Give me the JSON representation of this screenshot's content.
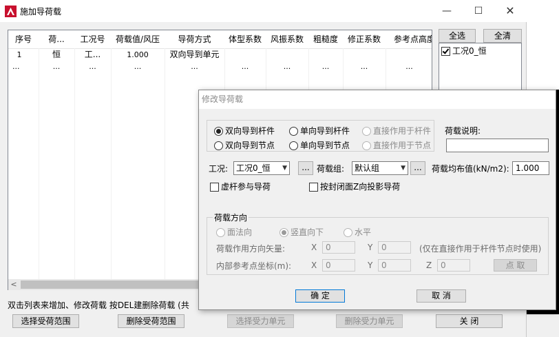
{
  "window": {
    "title": "施加导荷载",
    "minimize_glyph": "—",
    "maximize_glyph": "☐",
    "close_glyph": "✕"
  },
  "list": {
    "columns": [
      "序号",
      "荷...",
      "工况号",
      "荷载值/风压",
      "导荷方式",
      "体型系数",
      "风振系数",
      "粗糙度",
      "修正系数",
      "参考点高度"
    ],
    "rows": [
      [
        "1",
        "恒",
        "工...",
        "1.000",
        "双向导到单元",
        "",
        "",
        "",
        "",
        ""
      ],
      [
        "...",
        "...",
        "...",
        "...",
        "...",
        "...",
        "...",
        "...",
        "...",
        "..."
      ]
    ],
    "scroll_left_glyph": "<"
  },
  "side": {
    "select_all": "全选",
    "clear_all": "全清",
    "cases": [
      {
        "label": "工况0_恒",
        "checked": true
      }
    ]
  },
  "hint": "双击列表来增加、修改荷载   按DEL建删除荷载   (共",
  "bottom_buttons": {
    "select_range": "选择受荷范围",
    "delete_range": "删除受荷范围",
    "select_units": "选择受力单元",
    "delete_units": "删除受力单元",
    "close": "关    闭"
  },
  "dialog": {
    "title": "修改导荷载",
    "modes": [
      {
        "label": "双向导到杆件",
        "selected": true,
        "enabled": true
      },
      {
        "label": "单向导到杆件",
        "selected": false,
        "enabled": true
      },
      {
        "label": "直接作用于杆件",
        "selected": false,
        "enabled": false
      },
      {
        "label": "双向导到节点",
        "selected": false,
        "enabled": true
      },
      {
        "label": "单向导到节点",
        "selected": false,
        "enabled": true
      },
      {
        "label": "直接作用于节点",
        "selected": false,
        "enabled": false
      }
    ],
    "load_desc_label": "荷载说明:",
    "load_desc_value": "",
    "case_label": "工况:",
    "case_value": "工况0_恒",
    "ellipsis": "...",
    "group_label": "荷载组:",
    "group_value": "默认组",
    "dist_label": "荷载均布值(kN/m2):",
    "dist_value": "1.000",
    "virtual_rod": "虚杆参与导荷",
    "closed_surface": "按封闭面Z向投影导荷",
    "direction": {
      "title": "荷载方向",
      "options": [
        {
          "label": "面法向",
          "selected": false
        },
        {
          "label": "竖直向下",
          "selected": true
        },
        {
          "label": "水平",
          "selected": false
        }
      ],
      "vector_label": "荷载作用方向矢量:",
      "refpt_label": "内部参考点坐标(m):",
      "x": "X",
      "y": "Y",
      "z": "Z",
      "vx": "0",
      "vy": "0",
      "px": "0",
      "py": "0",
      "pz": "0",
      "note": "(仅在直接作用于杆件节点时使用)",
      "pick": "点 取"
    },
    "ok": "确  定",
    "cancel": "取  消"
  }
}
